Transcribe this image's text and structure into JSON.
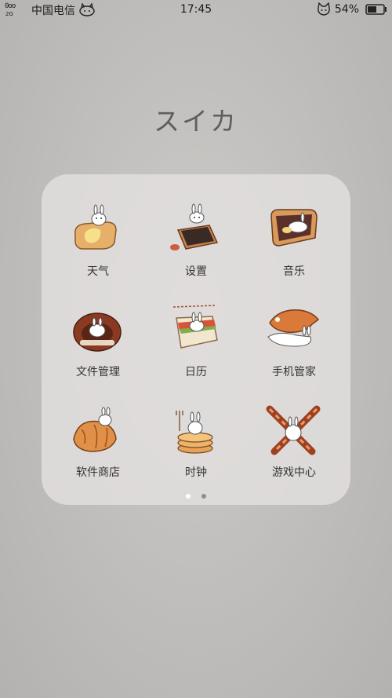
{
  "status_bar": {
    "signal_dots": "0oo",
    "network": "2G",
    "carrier": "中国电信",
    "time": "17:45",
    "battery": "54%"
  },
  "folder": {
    "title": "スイカ",
    "apps": [
      {
        "label": "天气",
        "icon": "bread-bunny-icon"
      },
      {
        "label": "设置",
        "icon": "burnt-toast-bunny-icon"
      },
      {
        "label": "音乐",
        "icon": "jam-toast-bunny-icon"
      },
      {
        "label": "文件管理",
        "icon": "chocolate-bun-bunny-icon"
      },
      {
        "label": "日历",
        "icon": "sandwich-bunny-icon"
      },
      {
        "label": "手机管家",
        "icon": "taiyaki-bunny-icon"
      },
      {
        "label": "软件商店",
        "icon": "croissant-bunny-icon"
      },
      {
        "label": "时钟",
        "icon": "pancake-bunny-icon"
      },
      {
        "label": "游戏中心",
        "icon": "bacon-bunny-icon"
      }
    ],
    "pages": {
      "count": 2,
      "active": 1
    }
  }
}
